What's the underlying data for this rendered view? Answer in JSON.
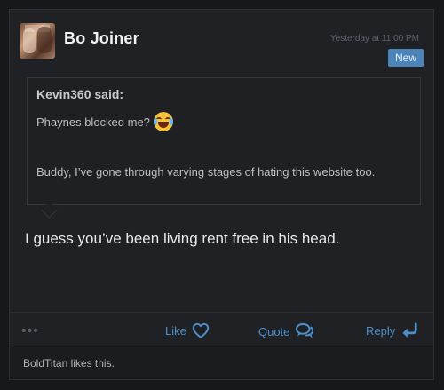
{
  "post": {
    "username": "Bo Joiner",
    "timestamp": "Yesterday at 11:00 PM",
    "badge": "New",
    "quote": {
      "author": "Kevin360 said:",
      "line1": "Phaynes blocked me?",
      "line2": "Buddy, I’ve gone through varying stages of hating this website too."
    },
    "message": "I guess you’ve been living rent free in his head.",
    "actions": {
      "more": "•••",
      "like": "Like",
      "quote": "Quote",
      "reply": "Reply"
    },
    "likes_text": "BoldTitan likes this."
  },
  "colors": {
    "accent": "#4d8fcb",
    "badge_bg": "#4a84b8",
    "background": "#17181a",
    "card": "#202125"
  },
  "icons": {
    "emoji": "tears-of-joy-emoji",
    "like": "heart-outline-icon",
    "quote": "speech-bubbles-icon",
    "reply": "reply-arrow-icon"
  }
}
